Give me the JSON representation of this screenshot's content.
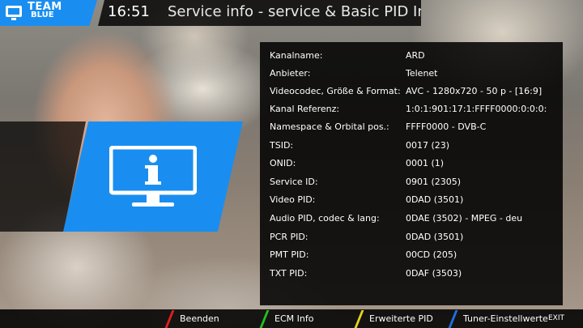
{
  "topbar": {
    "logo_line1": "TEAM",
    "logo_line2": "BLUE",
    "clock": "16:51",
    "title": "Service info - service & Basic PID Info"
  },
  "info_rows": [
    {
      "label": "Kanalname:",
      "value": "ARD"
    },
    {
      "label": "Anbieter:",
      "value": "Telenet"
    },
    {
      "label": "Videocodec, Größe & Format:",
      "value": "AVC - 1280x720 - 50 p - [16:9]"
    },
    {
      "label": "Kanal Referenz:",
      "value": "1:0:1:901:17:1:FFFF0000:0:0:0:"
    },
    {
      "label": "Namespace & Orbital pos.:",
      "value": "FFFF0000 - DVB-C"
    },
    {
      "label": "TSID:",
      "value": "0017 (23)"
    },
    {
      "label": "ONID:",
      "value": "0001 (1)"
    },
    {
      "label": "Service ID:",
      "value": "0901 (2305)"
    },
    {
      "label": "Video PID:",
      "value": "0DAD (3501)"
    },
    {
      "label": "Audio PID, codec & lang:",
      "value": "0DAE (3502) - MPEG - deu"
    },
    {
      "label": "PCR PID:",
      "value": "0DAD (3501)"
    },
    {
      "label": "PMT PID:",
      "value": "00CD (205)"
    },
    {
      "label": "TXT PID:",
      "value": "0DAF (3503)"
    }
  ],
  "buttons": [
    {
      "label": "Beenden",
      "color": "#e02020"
    },
    {
      "label": "ECM Info",
      "color": "#22c022"
    },
    {
      "label": "Erweiterte PID",
      "color": "#e8d020"
    },
    {
      "label": "Tuner-Einstellwerte",
      "color": "#2070e0"
    }
  ],
  "exit_key": "EXIT",
  "icons": {
    "logo": "team-blue-logo",
    "banner": "info-monitor-icon"
  },
  "colors": {
    "accent": "#1a8ef0",
    "panel": "#000000"
  }
}
